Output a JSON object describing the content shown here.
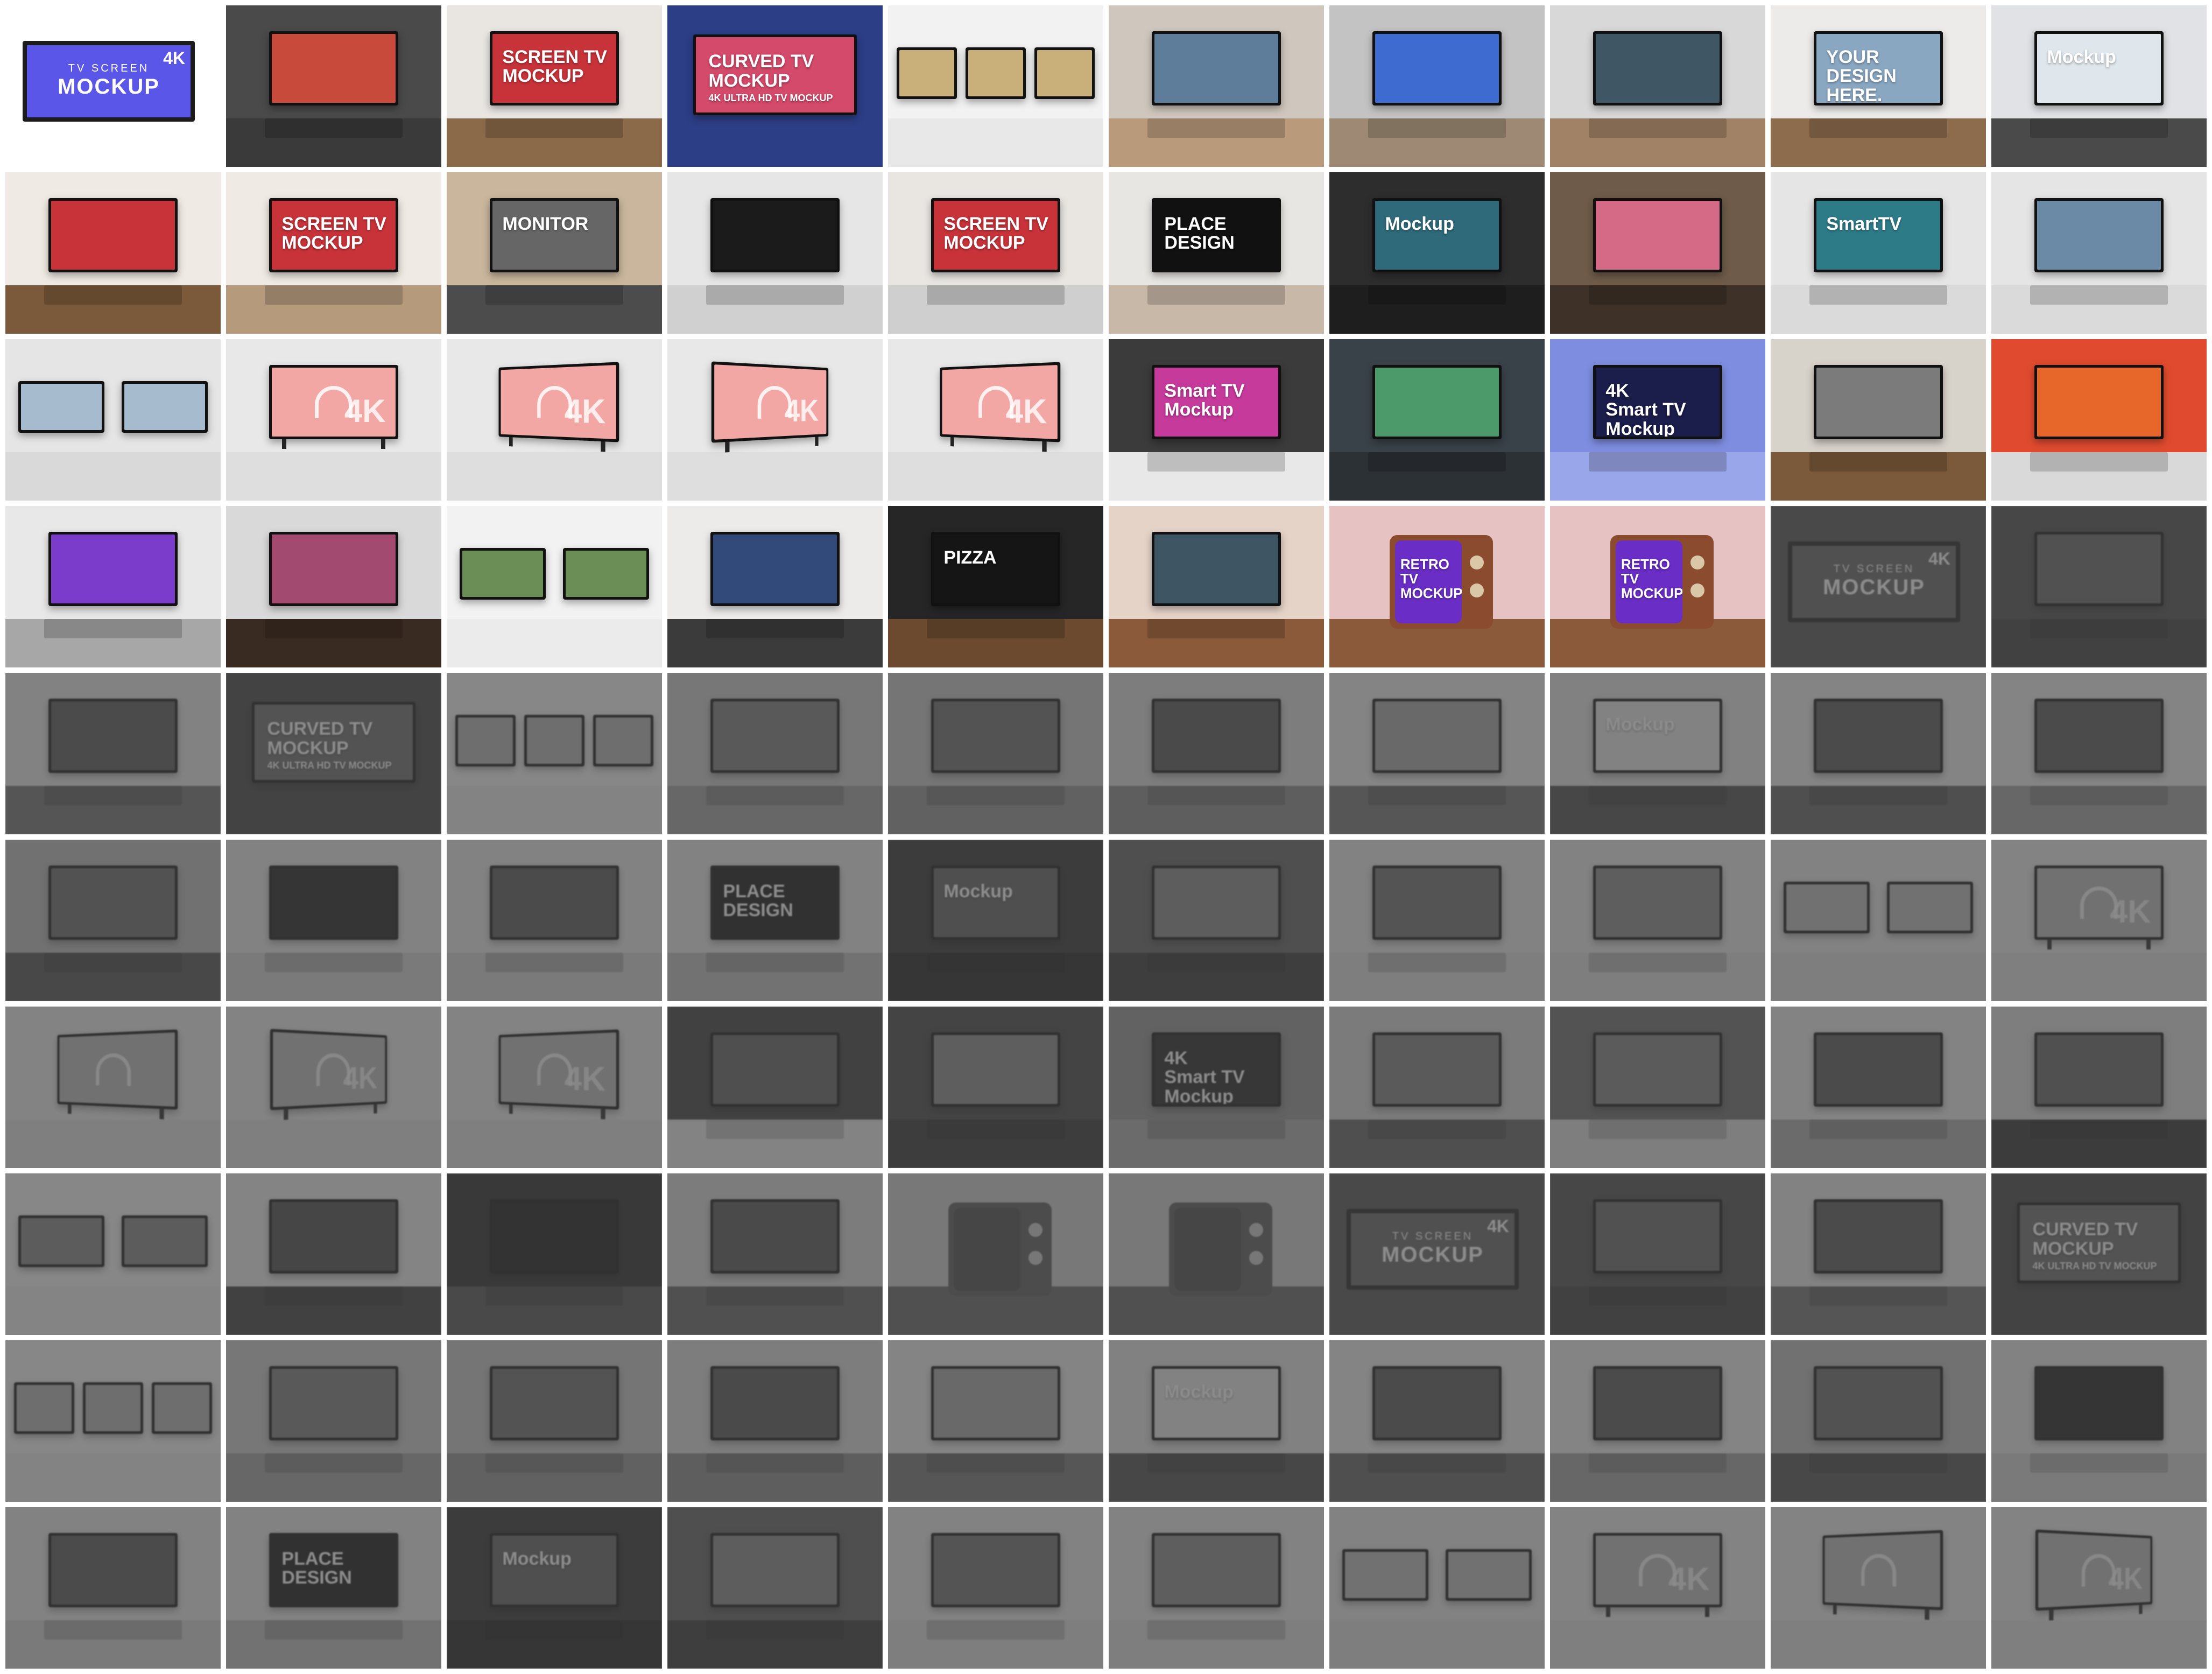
{
  "page": {
    "background": "#ffffff",
    "columns": 10,
    "rows": 10
  },
  "texts": {
    "hero_top": "TV SCREEN",
    "hero_main": "MOCKUP",
    "hero_4k": "4K",
    "curved": "CURVED TV\nMOCKUP",
    "curved_sub": "4K ULTRA HD TV MOCKUP",
    "screen_tv_mockup": "SCREEN TV MOCKUP",
    "mockup": "Mockup",
    "place_design": "PLACE\nDESIGN",
    "your_design": "YOUR\nDESIGN\nHERE.",
    "monitor": "MONITOR",
    "smart_tv": "Smart TV\nMockup",
    "four_k_smart": "4K\nSmart TV\nMockup",
    "retro": "RETRO\nTV MOCKUP",
    "pizza": "PIZZA",
    "four_k": "4K",
    "smarttv": "SmartTV"
  },
  "tiles": [
    {
      "kind": "hero",
      "wall": "#ffffff",
      "floor": "#ffffff",
      "screen": "#5a57e8",
      "label": "hero",
      "faded": false
    },
    {
      "kind": "tv",
      "wall": "#4a4a4a",
      "floor": "#3a3a3a",
      "screen": "#c84a3a",
      "text": "",
      "faded": false
    },
    {
      "kind": "tv",
      "wall": "#e9e6e2",
      "floor": "#8b6a4a",
      "screen": "#c8333a",
      "text": "screen_tv_mockup",
      "faded": false
    },
    {
      "kind": "curved",
      "wall": "#2c3e86",
      "floor": "#2c3e86",
      "screen": "#d44a6a",
      "text": "curved",
      "faded": false
    },
    {
      "kind": "triple",
      "wall": "#f2f2f2",
      "floor": "#e8e8e8",
      "screen": "#c9b07a",
      "text": "",
      "faded": false
    },
    {
      "kind": "tv",
      "wall": "#cfc7bd",
      "floor": "#b99a7a",
      "screen": "#5d7d9a",
      "text": "",
      "faded": false
    },
    {
      "kind": "tv",
      "wall": "#c3c3c3",
      "floor": "#9e8a74",
      "screen": "#3d6bd0",
      "text": "",
      "faded": false
    },
    {
      "kind": "tv",
      "wall": "#d8d8d8",
      "floor": "#a28266",
      "screen": "#3f5664",
      "text": "",
      "faded": false
    },
    {
      "kind": "tv",
      "wall": "#ecebea",
      "floor": "#8d6c4d",
      "screen": "#8aa7c2",
      "text": "your_design",
      "faded": false
    },
    {
      "kind": "tv",
      "wall": "#e1e2e6",
      "floor": "#4a4a4a",
      "screen": "#dfe7ec",
      "text": "mockup",
      "faded": false
    },
    {
      "kind": "tv",
      "wall": "#efeae3",
      "floor": "#7a5a3a",
      "screen": "#c8333a",
      "text": "",
      "faded": false
    },
    {
      "kind": "tv",
      "wall": "#efeae3",
      "floor": "#b59a7c",
      "screen": "#c8333a",
      "text": "screen_tv_mockup",
      "faded": false
    },
    {
      "kind": "tv",
      "wall": "#c9b69c",
      "floor": "#4c4c4c",
      "screen": "#666666",
      "text": "monitor",
      "faded": false
    },
    {
      "kind": "tv",
      "wall": "#e6e6e6",
      "floor": "#d0d0d0",
      "screen": "#1b1b1b",
      "text": "",
      "faded": false
    },
    {
      "kind": "tv",
      "wall": "#e9e6e2",
      "floor": "#cfcfcf",
      "screen": "#c8333a",
      "text": "screen_tv_mockup",
      "faded": false
    },
    {
      "kind": "tv",
      "wall": "#e8e6e2",
      "floor": "#c8b8a8",
      "screen": "#111111",
      "text": "place_design",
      "faded": false
    },
    {
      "kind": "tv",
      "wall": "#2d2d2d",
      "floor": "#1e1e1e",
      "screen": "#2f6a7a",
      "text": "mockup",
      "faded": false
    },
    {
      "kind": "tv",
      "wall": "#6e5b49",
      "floor": "#3d3128",
      "screen": "#d46a86",
      "text": "",
      "faded": false
    },
    {
      "kind": "tv",
      "wall": "#e5e5e5",
      "floor": "#dadada",
      "screen": "#2e7b88",
      "text": "smarttv",
      "faded": false
    },
    {
      "kind": "tv",
      "wall": "#e5e5e5",
      "floor": "#dadada",
      "screen": "#6a8aa5",
      "text": "",
      "faded": false
    },
    {
      "kind": "double",
      "wall": "#e5e5e5",
      "floor": "#d9d9d9",
      "screen": "#a7bbcf",
      "text": "",
      "faded": false
    },
    {
      "kind": "pink",
      "wall": "#e8e8e8",
      "floor": "#dedede",
      "screen": "#f2a7a4",
      "text": "four_k",
      "faded": false
    },
    {
      "kind": "pink",
      "wall": "#e8e8e8",
      "floor": "#dedede",
      "screen": "#f2a7a4",
      "text": "four_k",
      "faded": false,
      "tilt": "tilt"
    },
    {
      "kind": "pink",
      "wall": "#e8e8e8",
      "floor": "#dedede",
      "screen": "#f2a7a4",
      "text": "four_k",
      "faded": false,
      "tilt": "tilt2"
    },
    {
      "kind": "pink",
      "wall": "#e8e8e8",
      "floor": "#dedede",
      "screen": "#f2a7a4",
      "text": "four_k",
      "faded": false,
      "tilt": "tilt"
    },
    {
      "kind": "tv",
      "wall": "#3b3b3b",
      "floor": "#e8e8e8",
      "screen": "#c63a9b",
      "text": "smart_tv",
      "faded": false
    },
    {
      "kind": "tv",
      "wall": "#3a4249",
      "floor": "#2c3136",
      "screen": "#4c9a6a",
      "text": "",
      "faded": false
    },
    {
      "kind": "tv",
      "wall": "#7e8de0",
      "floor": "#9aa6ea",
      "screen": "#1b1d4a",
      "text": "four_k_smart",
      "faded": false
    },
    {
      "kind": "tv",
      "wall": "#d7d2ca",
      "floor": "#7a5a3a",
      "screen": "#7b7b7b",
      "text": "",
      "faded": false
    },
    {
      "kind": "tv",
      "wall": "#e04b2f",
      "floor": "#d9d9d9",
      "screen": "#e7662a",
      "text": "",
      "faded": false
    },
    {
      "kind": "tv",
      "wall": "#e8e8e8",
      "floor": "#a7a7a7",
      "screen": "#7b3ccc",
      "text": "",
      "faded": false
    },
    {
      "kind": "tv",
      "wall": "#d9d9d9",
      "floor": "#3a2b22",
      "screen": "#a34a70",
      "text": "",
      "faded": false
    },
    {
      "kind": "double",
      "wall": "#f2f2f2",
      "floor": "#ebebeb",
      "screen": "#6a8e55",
      "text": "",
      "faded": false
    },
    {
      "kind": "tv",
      "wall": "#ecebea",
      "floor": "#3b3b3b",
      "screen": "#314a7a",
      "text": "",
      "faded": false
    },
    {
      "kind": "tv",
      "wall": "#262626",
      "floor": "#6b4a2f",
      "screen": "#151515",
      "text": "pizza",
      "faded": false
    },
    {
      "kind": "tv",
      "wall": "#e6d3c8",
      "floor": "#8a5a3a",
      "screen": "#3e5564",
      "text": "",
      "faded": false
    },
    {
      "kind": "retro",
      "wall": "#e6c3c2",
      "floor": "#8a5a3a",
      "screen": "#6a2ec7",
      "text": "retro",
      "faded": false
    },
    {
      "kind": "retro",
      "wall": "#e6c3c2",
      "floor": "#8a5a3a",
      "screen": "#6a2ec7",
      "text": "retro",
      "faded": false
    },
    {
      "kind": "hero",
      "wall": "#4e4e4e",
      "floor": "#4e4e4e",
      "screen": "#5a57e8",
      "label": "hero",
      "faded": true
    },
    {
      "kind": "tv",
      "wall": "#4a4a4a",
      "floor": "#3a3a3a",
      "screen": "#c84a3a",
      "text": "",
      "faded": true
    },
    {
      "kind": "tv",
      "wall": "#e9e6e2",
      "floor": "#8b6a4a",
      "screen": "#c8333a",
      "text": "",
      "faded": true
    },
    {
      "kind": "curved",
      "wall": "#2c3e86",
      "floor": "#2c3e86",
      "screen": "#d44a6a",
      "text": "curved",
      "faded": true
    },
    {
      "kind": "triple",
      "wall": "#f2f2f2",
      "floor": "#e8e8e8",
      "screen": "#c9b07a",
      "text": "",
      "faded": true
    },
    {
      "kind": "tv",
      "wall": "#cfc7bd",
      "floor": "#b99a7a",
      "screen": "#5d7d9a",
      "text": "",
      "faded": true
    },
    {
      "kind": "tv",
      "wall": "#c3c3c3",
      "floor": "#9e8a74",
      "screen": "#3d6bd0",
      "text": "",
      "faded": true
    },
    {
      "kind": "tv",
      "wall": "#d8d8d8",
      "floor": "#a28266",
      "screen": "#3f5664",
      "text": "",
      "faded": true
    },
    {
      "kind": "tv",
      "wall": "#ecebea",
      "floor": "#8d6c4d",
      "screen": "#8aa7c2",
      "text": "",
      "faded": true
    },
    {
      "kind": "tv",
      "wall": "#e1e2e6",
      "floor": "#4a4a4a",
      "screen": "#dfe7ec",
      "text": "mockup",
      "faded": true
    },
    {
      "kind": "tv",
      "wall": "#efeae3",
      "floor": "#7a5a3a",
      "screen": "#c8333a",
      "text": "",
      "faded": true
    },
    {
      "kind": "tv",
      "wall": "#efeae3",
      "floor": "#b59a7c",
      "screen": "#c8333a",
      "text": "",
      "faded": true
    },
    {
      "kind": "tv",
      "wall": "#c9b69c",
      "floor": "#4c4c4c",
      "screen": "#666666",
      "text": "",
      "faded": true
    },
    {
      "kind": "tv",
      "wall": "#e6e6e6",
      "floor": "#d0d0d0",
      "screen": "#1b1b1b",
      "text": "",
      "faded": true
    },
    {
      "kind": "tv",
      "wall": "#e9e6e2",
      "floor": "#cfcfcf",
      "screen": "#c8333a",
      "text": "",
      "faded": true
    },
    {
      "kind": "tv",
      "wall": "#e8e6e2",
      "floor": "#c8b8a8",
      "screen": "#111111",
      "text": "place_design",
      "faded": true
    },
    {
      "kind": "tv",
      "wall": "#2d2d2d",
      "floor": "#1e1e1e",
      "screen": "#2f6a7a",
      "text": "mockup",
      "faded": true
    },
    {
      "kind": "tv",
      "wall": "#6e5b49",
      "floor": "#3d3128",
      "screen": "#d46a86",
      "text": "",
      "faded": true
    },
    {
      "kind": "tv",
      "wall": "#e5e5e5",
      "floor": "#dadada",
      "screen": "#2e7b88",
      "text": "",
      "faded": true
    },
    {
      "kind": "tv",
      "wall": "#e5e5e5",
      "floor": "#dadada",
      "screen": "#6a8aa5",
      "text": "",
      "faded": true
    },
    {
      "kind": "double",
      "wall": "#e5e5e5",
      "floor": "#d9d9d9",
      "screen": "#a7bbcf",
      "text": "",
      "faded": true
    },
    {
      "kind": "pink",
      "wall": "#e8e8e8",
      "floor": "#dedede",
      "screen": "#f2a7a4",
      "text": "four_k",
      "faded": true
    },
    {
      "kind": "pink",
      "wall": "#e8e8e8",
      "floor": "#dedede",
      "screen": "#f2a7a4",
      "text": "",
      "faded": true,
      "tilt": "tilt"
    },
    {
      "kind": "pink",
      "wall": "#e8e8e8",
      "floor": "#dedede",
      "screen": "#f2a7a4",
      "text": "four_k",
      "faded": true,
      "tilt": "tilt2"
    },
    {
      "kind": "pink",
      "wall": "#e8e8e8",
      "floor": "#dedede",
      "screen": "#f2a7a4",
      "text": "four_k",
      "faded": true,
      "tilt": "tilt"
    },
    {
      "kind": "tv",
      "wall": "#3b3b3b",
      "floor": "#e8e8e8",
      "screen": "#c63a9b",
      "text": "",
      "faded": true
    },
    {
      "kind": "tv",
      "wall": "#3a4249",
      "floor": "#2c3136",
      "screen": "#4c9a6a",
      "text": "",
      "faded": true
    },
    {
      "kind": "tv",
      "wall": "#7e8de0",
      "floor": "#9aa6ea",
      "screen": "#1b1d4a",
      "text": "four_k_smart",
      "faded": true
    },
    {
      "kind": "tv",
      "wall": "#d7d2ca",
      "floor": "#7a5a3a",
      "screen": "#7b7b7b",
      "text": "",
      "faded": true
    },
    {
      "kind": "tv",
      "wall": "#e04b2f",
      "floor": "#d9d9d9",
      "screen": "#e7662a",
      "text": "",
      "faded": true
    },
    {
      "kind": "tv",
      "wall": "#e8e8e8",
      "floor": "#a7a7a7",
      "screen": "#7b3ccc",
      "text": "",
      "faded": true
    },
    {
      "kind": "tv",
      "wall": "#d9d9d9",
      "floor": "#3a2b22",
      "screen": "#a34a70",
      "text": "",
      "faded": true
    },
    {
      "kind": "double",
      "wall": "#f2f2f2",
      "floor": "#ebebeb",
      "screen": "#6a8e55",
      "text": "",
      "faded": true
    },
    {
      "kind": "tv",
      "wall": "#ecebea",
      "floor": "#3b3b3b",
      "screen": "#314a7a",
      "text": "",
      "faded": true
    },
    {
      "kind": "tv",
      "wall": "#262626",
      "floor": "#6b4a2f",
      "screen": "#151515",
      "text": "",
      "faded": true
    },
    {
      "kind": "tv",
      "wall": "#e6d3c8",
      "floor": "#8a5a3a",
      "screen": "#3e5564",
      "text": "",
      "faded": true
    },
    {
      "kind": "retro",
      "wall": "#e6c3c2",
      "floor": "#8a5a3a",
      "screen": "#6a2ec7",
      "text": "",
      "faded": true
    },
    {
      "kind": "retro",
      "wall": "#e6c3c2",
      "floor": "#8a5a3a",
      "screen": "#6a2ec7",
      "text": "",
      "faded": true
    },
    {
      "kind": "hero",
      "wall": "#4e4e4e",
      "floor": "#4e4e4e",
      "screen": "#5a57e8",
      "label": "hero",
      "faded": true
    },
    {
      "kind": "tv",
      "wall": "#4a4a4a",
      "floor": "#3a3a3a",
      "screen": "#c84a3a",
      "text": "",
      "faded": true
    },
    {
      "kind": "tv",
      "wall": "#e9e6e2",
      "floor": "#8b6a4a",
      "screen": "#c8333a",
      "text": "",
      "faded": true
    },
    {
      "kind": "curved",
      "wall": "#2c3e86",
      "floor": "#2c3e86",
      "screen": "#d44a6a",
      "text": "curved",
      "faded": true
    },
    {
      "kind": "triple",
      "wall": "#f2f2f2",
      "floor": "#e8e8e8",
      "screen": "#c9b07a",
      "text": "",
      "faded": true
    },
    {
      "kind": "tv",
      "wall": "#cfc7bd",
      "floor": "#b99a7a",
      "screen": "#5d7d9a",
      "text": "",
      "faded": true
    },
    {
      "kind": "tv",
      "wall": "#c3c3c3",
      "floor": "#9e8a74",
      "screen": "#3d6bd0",
      "text": "",
      "faded": true
    },
    {
      "kind": "tv",
      "wall": "#d8d8d8",
      "floor": "#a28266",
      "screen": "#3f5664",
      "text": "",
      "faded": true
    },
    {
      "kind": "tv",
      "wall": "#ecebea",
      "floor": "#8d6c4d",
      "screen": "#8aa7c2",
      "text": "",
      "faded": true
    },
    {
      "kind": "tv",
      "wall": "#e1e2e6",
      "floor": "#4a4a4a",
      "screen": "#dfe7ec",
      "text": "mockup",
      "faded": true
    },
    {
      "kind": "tv",
      "wall": "#efeae3",
      "floor": "#7a5a3a",
      "screen": "#c8333a",
      "text": "",
      "faded": true
    },
    {
      "kind": "tv",
      "wall": "#efeae3",
      "floor": "#b59a7c",
      "screen": "#c8333a",
      "text": "",
      "faded": true
    },
    {
      "kind": "tv",
      "wall": "#c9b69c",
      "floor": "#4c4c4c",
      "screen": "#666666",
      "text": "",
      "faded": true
    },
    {
      "kind": "tv",
      "wall": "#e6e6e6",
      "floor": "#d0d0d0",
      "screen": "#1b1b1b",
      "text": "",
      "faded": true
    },
    {
      "kind": "tv",
      "wall": "#e9e6e2",
      "floor": "#cfcfcf",
      "screen": "#c8333a",
      "text": "",
      "faded": true
    },
    {
      "kind": "tv",
      "wall": "#e8e6e2",
      "floor": "#c8b8a8",
      "screen": "#111111",
      "text": "place_design",
      "faded": true
    },
    {
      "kind": "tv",
      "wall": "#2d2d2d",
      "floor": "#1e1e1e",
      "screen": "#2f6a7a",
      "text": "mockup",
      "faded": true
    },
    {
      "kind": "tv",
      "wall": "#6e5b49",
      "floor": "#3d3128",
      "screen": "#d46a86",
      "text": "",
      "faded": true
    },
    {
      "kind": "tv",
      "wall": "#e5e5e5",
      "floor": "#dadada",
      "screen": "#2e7b88",
      "text": "",
      "faded": true
    },
    {
      "kind": "tv",
      "wall": "#e5e5e5",
      "floor": "#dadada",
      "screen": "#6a8aa5",
      "text": "",
      "faded": true
    },
    {
      "kind": "double",
      "wall": "#e5e5e5",
      "floor": "#d9d9d9",
      "screen": "#a7bbcf",
      "text": "",
      "faded": true
    },
    {
      "kind": "pink",
      "wall": "#e8e8e8",
      "floor": "#dedede",
      "screen": "#f2a7a4",
      "text": "four_k",
      "faded": true
    },
    {
      "kind": "pink",
      "wall": "#e8e8e8",
      "floor": "#dedede",
      "screen": "#f2a7a4",
      "text": "",
      "faded": true,
      "tilt": "tilt"
    },
    {
      "kind": "pink",
      "wall": "#e8e8e8",
      "floor": "#dedede",
      "screen": "#f2a7a4",
      "text": "four_k",
      "faded": true,
      "tilt": "tilt2"
    }
  ]
}
